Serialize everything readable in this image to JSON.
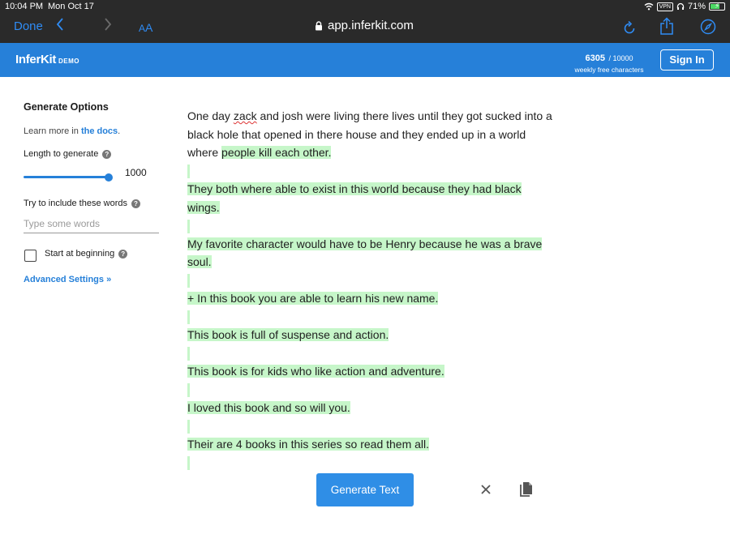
{
  "status_bar": {
    "time": "10:04 PM",
    "date": "Mon Oct 17",
    "vpn": "VPN",
    "battery": "71%"
  },
  "browser": {
    "done_label": "Done",
    "text_size_small": "A",
    "text_size_big": "A",
    "url": "app.inferkit.com"
  },
  "header": {
    "logo": "InferKit",
    "logo_tag": "DEMO",
    "chars_used": "6305",
    "chars_total": "/ 10000",
    "chars_caption": "weekly free characters",
    "sign_in_label": "Sign In"
  },
  "sidebar": {
    "title": "Generate Options",
    "learn_prefix": "Learn more in ",
    "learn_link": "the docs",
    "learn_suffix": ".",
    "length_label": "Length to generate",
    "length_value": "1000",
    "length_fraction": 1.0,
    "include_label": "Try to include these words",
    "include_placeholder": "Type some words",
    "include_value": "",
    "start_label": "Start at beginning",
    "start_checked": false,
    "advanced_label": "Advanced Settings »",
    "help_glyph": "?"
  },
  "editor": {
    "prompt_part1": "One day ",
    "prompt_misspelled": "zack",
    "prompt_part2": " and josh were living there lives until they got sucked into a black hole that opened in there house and they ended up in a world where ",
    "generated_first": "people kill each other.",
    "generated_paragraphs": [
      "They both where able to exist in this world because they had black wings.",
      "My favorite character would have to be Henry because he was a brave soul.",
      "+ In this book you are able to learn his new name.",
      "This book is full of suspense and action.",
      "This book is for kids who like action and adventure.",
      "I loved this book and so will you.",
      "Their are 4 books in this series so read them all."
    ]
  },
  "actions": {
    "generate_label": "Generate Text",
    "clear_icon": "close-icon",
    "copy_icon": "copy-icon"
  },
  "colors": {
    "brand_blue": "#2680d9",
    "button_blue": "#2f8ee6",
    "highlight_green": "#c6f6c9",
    "browser_chrome": "#2a2a2a",
    "safari_blue": "#2f8cf5"
  }
}
